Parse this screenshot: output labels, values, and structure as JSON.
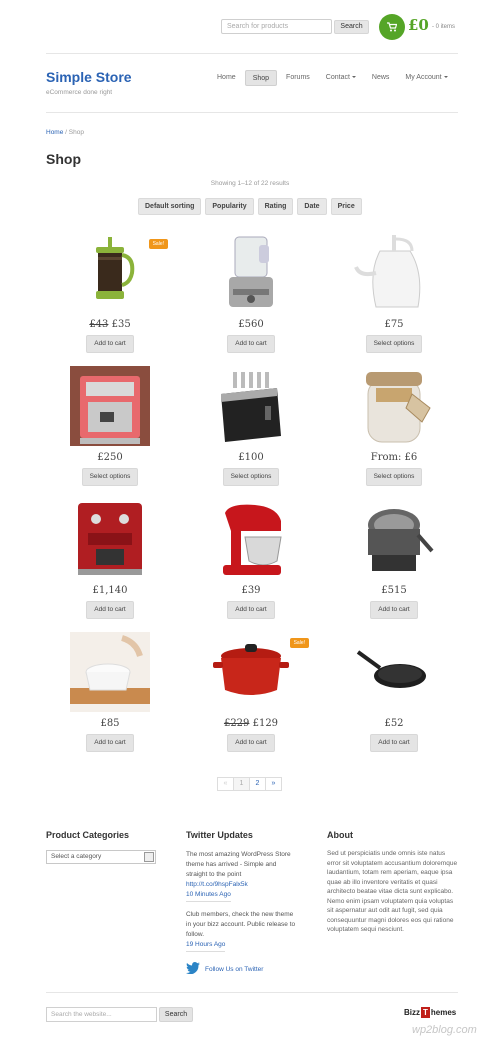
{
  "topbar": {
    "search_placeholder": "Search for products",
    "search_button": "Search",
    "cart_total": "£0",
    "cart_items": "- 0 items",
    "cart_color": "#55a527"
  },
  "header": {
    "site_title": "Simple Store",
    "tagline": "eCommerce done right",
    "nav": [
      {
        "label": "Home"
      },
      {
        "label": "Shop",
        "active": true
      },
      {
        "label": "Forums"
      },
      {
        "label": "Contact",
        "dropdown": true
      },
      {
        "label": "News"
      },
      {
        "label": "My Account",
        "dropdown": true
      }
    ]
  },
  "breadcrumb": {
    "home": "Home",
    "separator": "/",
    "current": "Shop"
  },
  "page_title": "Shop",
  "results_text": "Showing 1–12 of 22 results",
  "sort_buttons": [
    "Default sorting",
    "Popularity",
    "Rating",
    "Date",
    "Price"
  ],
  "products": [
    {
      "image": "french-press",
      "old_price": "£43",
      "price": "£35",
      "button": "Add to cart",
      "sale": "Sale!"
    },
    {
      "image": "food-processor",
      "price": "£560",
      "button": "Add to cart"
    },
    {
      "image": "white-kettle",
      "price": "£75",
      "button": "Select options"
    },
    {
      "image": "espresso-machine-pink",
      "price": "£250",
      "button": "Select options"
    },
    {
      "image": "toaster",
      "price": "£100",
      "button": "Select options"
    },
    {
      "image": "glass-jar",
      "price": "From: £6",
      "button": "Select options"
    },
    {
      "image": "espresso-machine-red",
      "price": "£1,140",
      "button": "Add to cart"
    },
    {
      "image": "stand-mixer",
      "price": "£39",
      "button": "Add to cart"
    },
    {
      "image": "waffle-maker",
      "price": "£515",
      "button": "Add to cart"
    },
    {
      "image": "mixing-bowl",
      "price": "£85",
      "button": "Add to cart"
    },
    {
      "image": "casserole-pot",
      "old_price": "£229",
      "price": "£129",
      "button": "Add to cart",
      "sale": "Sale!"
    },
    {
      "image": "frying-pan",
      "price": "£52",
      "button": "Add to cart"
    }
  ],
  "pagination": [
    "«",
    "1",
    "2",
    "»"
  ],
  "footer": {
    "categories_title": "Product Categories",
    "category_select": "Select a category",
    "twitter_title": "Twitter Updates",
    "tweets": [
      {
        "text": "The most amazing WordPress Store theme has arrived - Simple and straight to the point",
        "link": "http://t.co/9hspFalx5k",
        "time": "10 Minutes Ago"
      },
      {
        "text": "Club members, check the new theme in your bizz account. Public release to follow.",
        "time": "19 Hours Ago"
      }
    ],
    "follow_text": "Follow Us on Twitter",
    "about_title": "About",
    "about_text": "Sed ut perspiciatis unde omnis iste natus error sit voluptatem accusantium doloremque laudantium, totam rem aperiam, eaque ipsa quae ab illo inventore veritatis et quasi architecto beatae vitae dicta sunt explicabo. Nemo enim ipsam voluptatem quia voluptas sit aspernatur aut odit aut fugit, sed quia consequuntur magni dolores eos qui ratione voluptatem sequi nesciunt."
  },
  "bottom": {
    "search_placeholder": "Search the website...",
    "search_button": "Search",
    "logo_a": "Bizz",
    "logo_b": "T",
    "logo_c": "hemes",
    "watermark": "wp2blog.com"
  }
}
